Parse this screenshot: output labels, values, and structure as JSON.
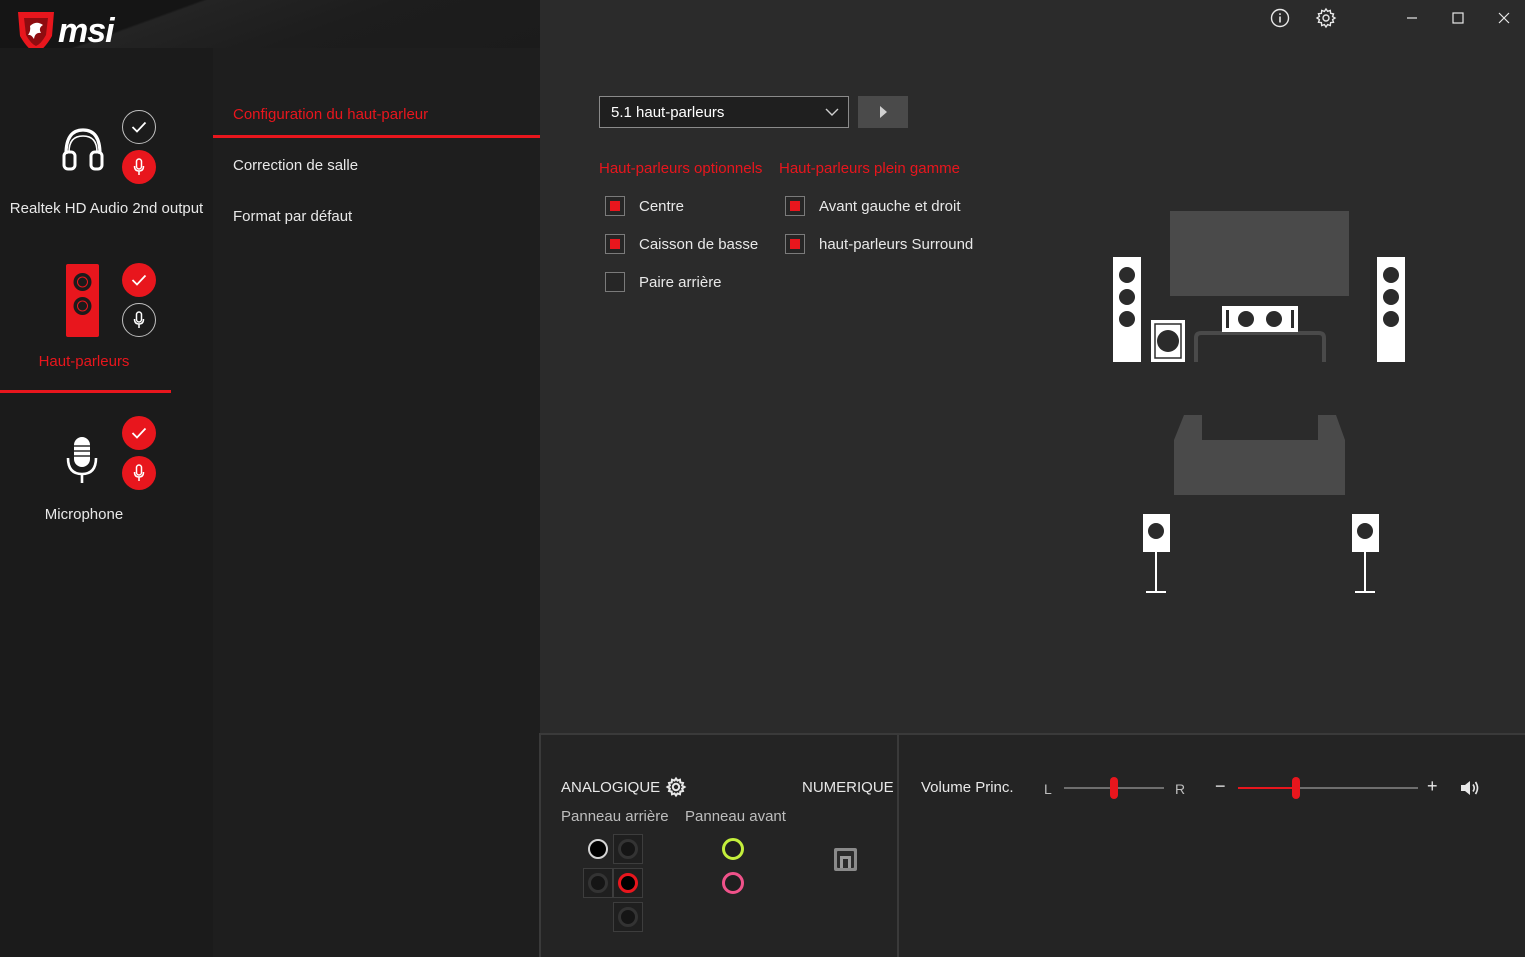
{
  "app": {
    "brand": "msi"
  },
  "window_controls": [
    "info-icon",
    "settings-icon",
    "minimize-icon",
    "maximize-icon",
    "close-icon"
  ],
  "devices": [
    {
      "label": "Realtek HD Audio 2nd output",
      "icon": "headphones-icon",
      "active": false
    },
    {
      "label": "Haut-parleurs",
      "icon": "speaker-icon",
      "active": true
    },
    {
      "label": "Microphone",
      "icon": "microphone-icon",
      "active": false
    }
  ],
  "nav": {
    "items": [
      {
        "label": "Configuration du haut-parleur",
        "active": true
      },
      {
        "label": "Correction de salle",
        "active": false
      },
      {
        "label": "Format par défaut",
        "active": false
      }
    ]
  },
  "config": {
    "selected": "5.1 haut-parleurs",
    "optional_title": "Haut-parleurs optionnels",
    "fullrange_title": "Haut-parleurs plein gamme",
    "optional": [
      {
        "label": "Centre",
        "checked": true
      },
      {
        "label": "Caisson de basse",
        "checked": true
      },
      {
        "label": "Paire arrière",
        "checked": false
      }
    ],
    "fullrange": [
      {
        "label": "Avant gauche et droit",
        "checked": true
      },
      {
        "label": "haut-parleurs Surround",
        "checked": true
      }
    ]
  },
  "bottom": {
    "analog_label": "ANALOGIQUE",
    "digital_label": "NUMERIQUE",
    "rear_panel_label": "Panneau arrière",
    "front_panel_label": "Panneau avant",
    "volume_label": "Volume Princ.",
    "balance_left": "L",
    "balance_right": "R",
    "volume_minus": "−",
    "volume_plus": "+",
    "balance_level": 0.5,
    "volume_level": 0.32
  },
  "colors": {
    "accent": "#e8161d",
    "jack_green": "#c4ef3c",
    "jack_pink": "#f0528a"
  }
}
